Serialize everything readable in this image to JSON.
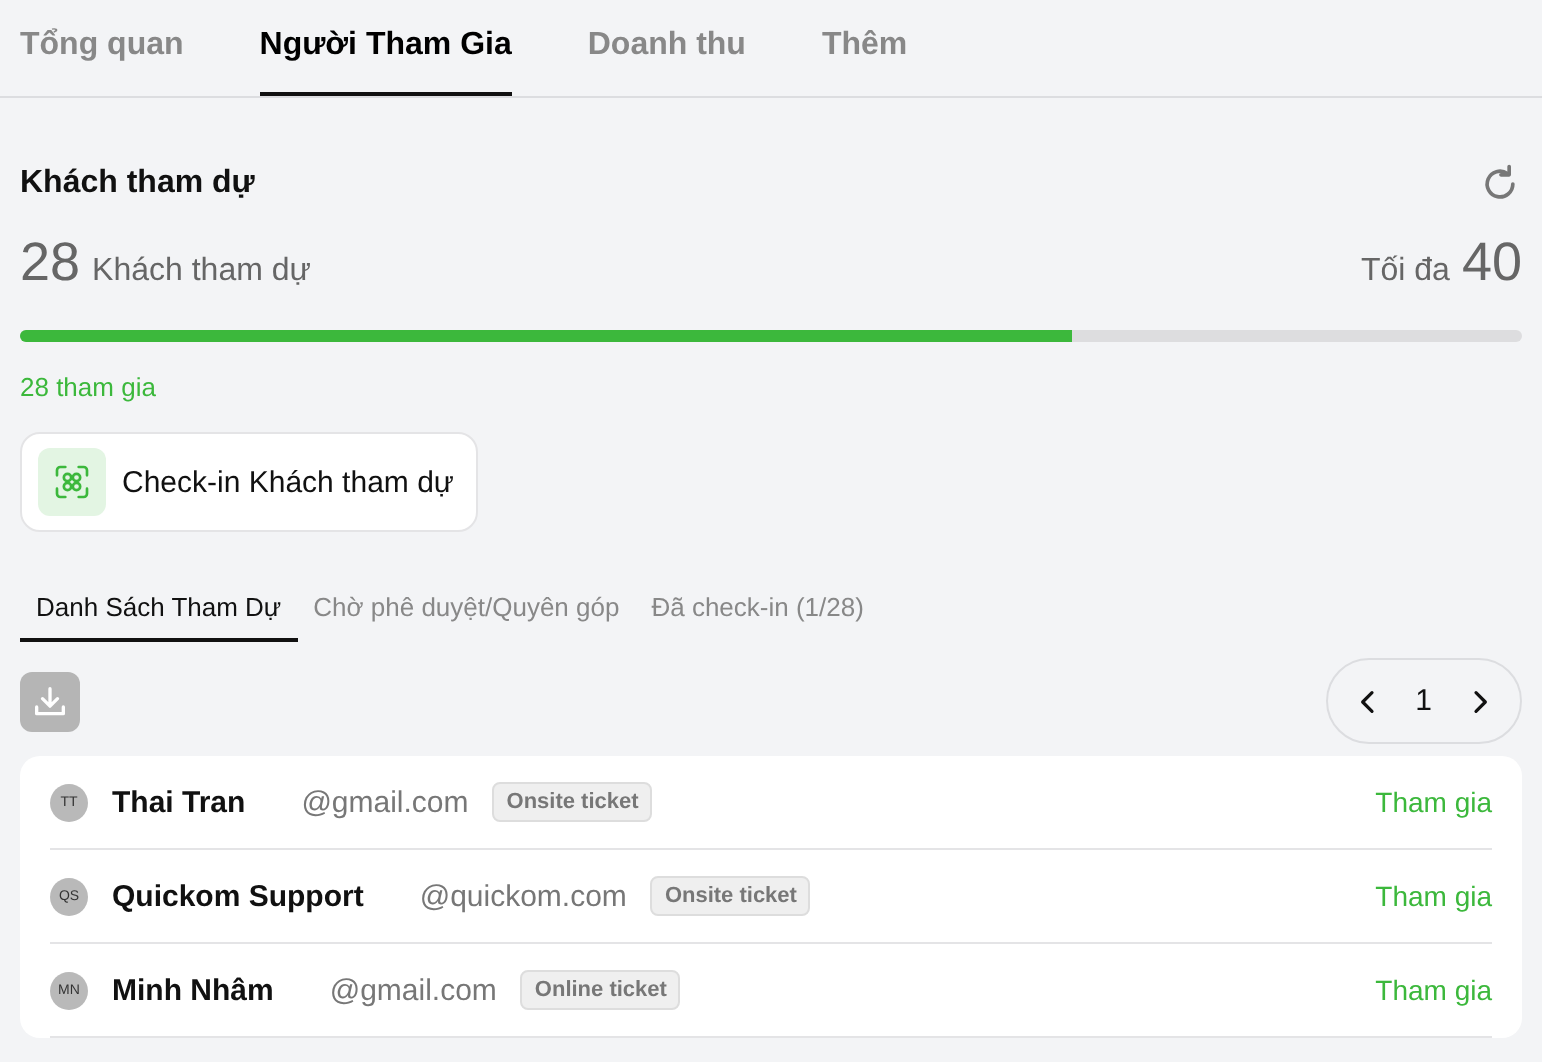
{
  "tabs": [
    {
      "label": "Tổng quan",
      "selected": false
    },
    {
      "label": "Người Tham Gia",
      "selected": true
    },
    {
      "label": "Doanh thu",
      "selected": false
    },
    {
      "label": "Thêm",
      "selected": false
    }
  ],
  "section": {
    "title": "Khách tham dự",
    "count": "28",
    "count_label": "Khách tham dự",
    "max_label": "Tối đa",
    "max": "40",
    "level": 0.7,
    "joined": "28 tham gia"
  },
  "checkin_button": "Check-in Khách tham dự",
  "subtabs": [
    {
      "label": "Danh Sách Tham Dự",
      "selected": true
    },
    {
      "label": "Chờ phê duyệt/Quyên góp",
      "selected": false
    },
    {
      "label": "Đã check-in (1/28)",
      "selected": false
    }
  ],
  "pagination": {
    "page": "1"
  },
  "attendees": [
    {
      "initials": "TT",
      "name": "Thai Tran",
      "email": "@gmail.com",
      "ticket": "Onsite ticket",
      "status": "Tham gia"
    },
    {
      "initials": "QS",
      "name": "Quickom Support",
      "email": "@quickom.com",
      "ticket": "Onsite ticket",
      "status": "Tham gia"
    },
    {
      "initials": "MN",
      "name": "Minh Nhâm",
      "email": "@gmail.com",
      "ticket": "Online ticket",
      "status": "Tham gia"
    }
  ]
}
